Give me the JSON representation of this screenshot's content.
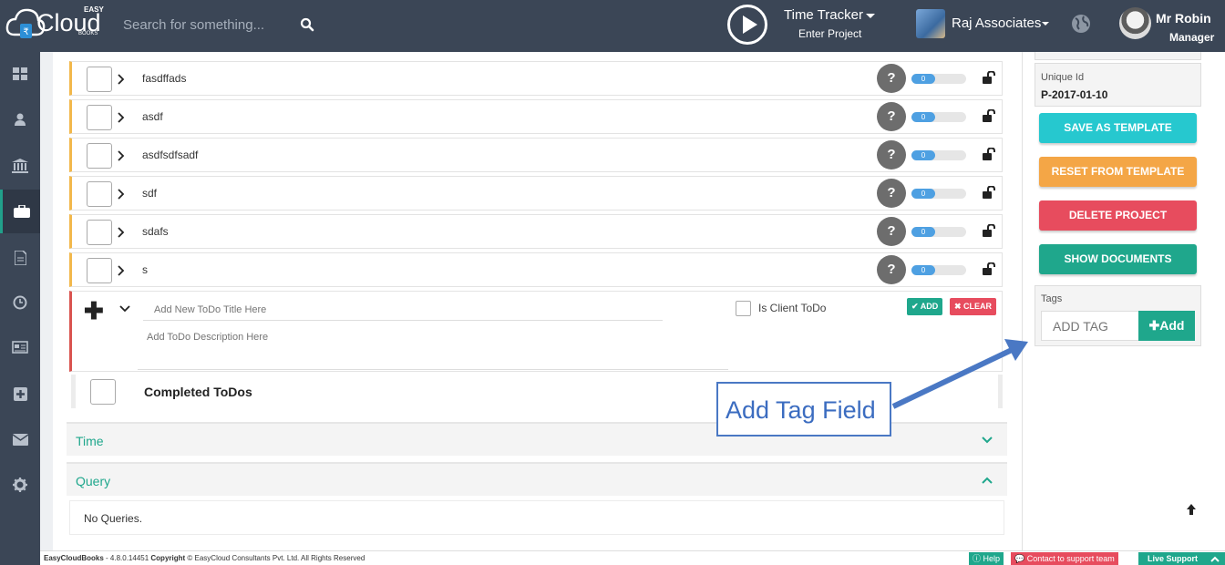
{
  "app": {
    "logo_easy": "EASY",
    "logo_text": "Cloud",
    "logo_books": "BOOKS"
  },
  "header": {
    "search_placeholder": "Search for something...",
    "time_tracker_label": "Time Tracker",
    "time_tracker_sub": "Enter Project",
    "company_name": "Raj Associates",
    "user_name": "Mr Robin",
    "user_role": "Manager"
  },
  "sidebar": {
    "items": [
      {
        "icon": "dashboard-icon"
      },
      {
        "icon": "user-icon"
      },
      {
        "icon": "bank-icon"
      },
      {
        "icon": "briefcase-icon",
        "active": true
      },
      {
        "icon": "document-icon"
      },
      {
        "icon": "clock-icon"
      },
      {
        "icon": "newspaper-icon"
      },
      {
        "icon": "plus-square-icon"
      },
      {
        "icon": "envelope-icon"
      },
      {
        "icon": "gear-icon"
      }
    ]
  },
  "todos": [
    {
      "title": "fasdffads",
      "progress": 0,
      "help": "?"
    },
    {
      "title": "asdf",
      "progress": 0,
      "help": "?"
    },
    {
      "title": "asdfsdfsadf",
      "progress": 0,
      "help": "?"
    },
    {
      "title": "sdf",
      "progress": 0,
      "help": "?"
    },
    {
      "title": "sdafs",
      "progress": 0,
      "help": "?"
    },
    {
      "title": "s",
      "progress": 0,
      "help": "?"
    }
  ],
  "new_todo": {
    "title_placeholder": "Add New ToDo Title Here",
    "description_placeholder": "Add ToDo Description Here",
    "client_todo_label": "Is Client ToDo",
    "add_label": "✔ ADD",
    "clear_label": "✖ CLEAR"
  },
  "completed": {
    "label": "Completed ToDos"
  },
  "sections": {
    "time_label": "Time",
    "query_label": "Query",
    "no_queries": "No Queries."
  },
  "right_panel": {
    "unique_id_label": "Unique Id",
    "unique_id_value": "P-2017-01-10",
    "save_template": "SAVE AS TEMPLATE",
    "reset_template": "RESET FROM TEMPLATE",
    "delete_project": "DELETE PROJECT",
    "show_documents": "SHOW DOCUMENTS",
    "tags_label": "Tags",
    "tag_placeholder": "ADD TAG",
    "tag_add_label": "✚Add"
  },
  "annotation": {
    "label": "Add Tag Field"
  },
  "footer": {
    "app_name": "EasyCloudBooks",
    "version": " - 4.8.0.14451 ",
    "copyright_label": "Copyright",
    "copyright_text": " © EasyCloud Consultants Pvt. Ltd. All Rights Reserved",
    "help": "ⓘ Help",
    "contact": "💬 Contact to support team",
    "live_support": "Live Support"
  },
  "colors": {
    "topbar": "#3b4656",
    "accent_green": "#1fa78c",
    "teal_button": "#26c8cf",
    "orange_button": "#f4a646",
    "red_button": "#e74c5e",
    "todo_border": "#f2b84b",
    "progress_blue": "#4ea0e2",
    "annotation_blue": "#4a78c4"
  }
}
